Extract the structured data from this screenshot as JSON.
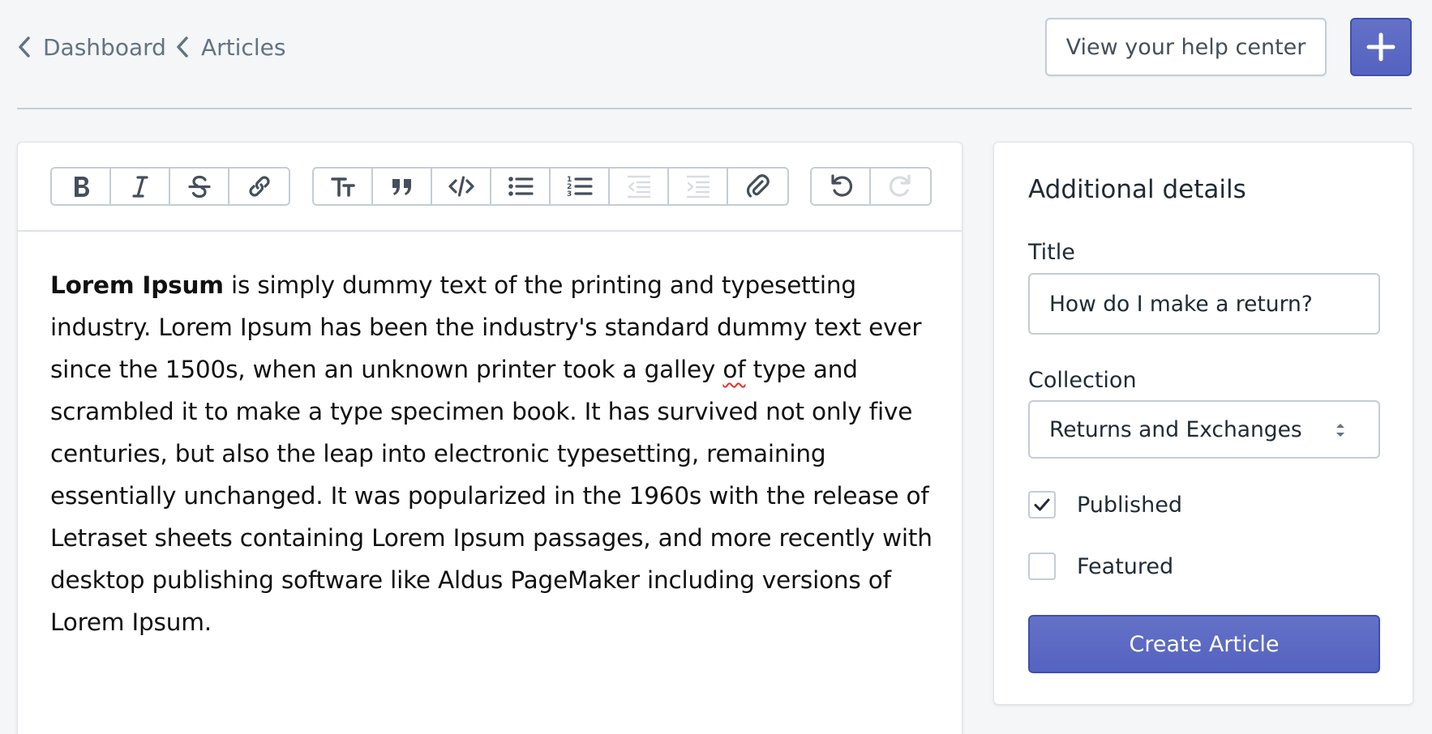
{
  "breadcrumbs": [
    {
      "label": "Dashboard"
    },
    {
      "label": "Articles"
    }
  ],
  "header": {
    "help_button_label": "View your help center",
    "add_button_icon": "plus-icon"
  },
  "editor": {
    "toolbar_groups": [
      [
        "bold-icon",
        "italic-icon",
        "strikethrough-icon",
        "link-icon"
      ],
      [
        "heading-icon",
        "quote-icon",
        "code-icon",
        "bullet-list-icon",
        "numbered-list-icon",
        "outdent-icon",
        "indent-icon",
        "attachment-icon"
      ],
      [
        "undo-icon",
        "redo-icon"
      ]
    ],
    "content_bold": "Lorem Ipsum",
    "content_part1": " is simply dummy text of the printing and typesetting industry. Lorem Ipsum has been the industry's standard dummy text ever since the 1500s, when an unknown printer took a galley ",
    "content_misspelled": "of",
    "content_part2": " type and scrambled it to make a type specimen book. It has survived not only five centuries, but also the leap into electronic typesetting, remaining essentially unchanged. It was popularized in the 1960s with the release of Letraset sheets containing Lorem Ipsum passages, and more recently with desktop publishing software like Aldus PageMaker including versions of Lorem Ipsum."
  },
  "details": {
    "heading": "Additional details",
    "title_label": "Title",
    "title_value": "How do I make a return?",
    "collection_label": "Collection",
    "collection_value": "Returns and Exchanges",
    "published_label": "Published",
    "published_checked": true,
    "featured_label": "Featured",
    "featured_checked": false,
    "create_button_label": "Create Article"
  },
  "colors": {
    "primary": "#5c6ac4",
    "background": "#f4f6f8",
    "border": "#c4cdd5"
  }
}
